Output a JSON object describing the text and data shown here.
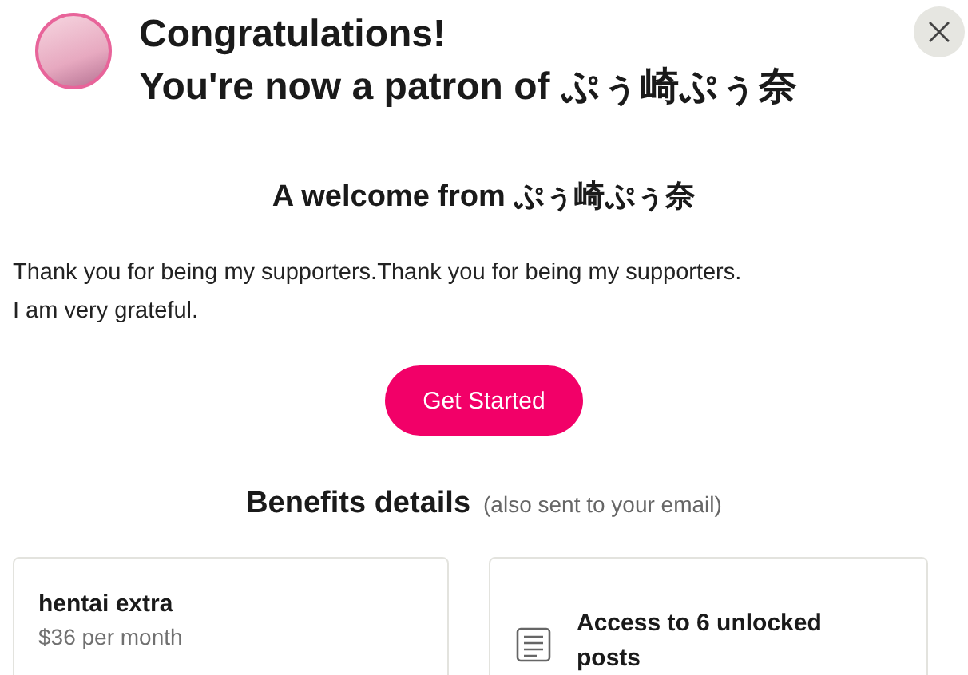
{
  "header": {
    "title_lines": [
      "Congratulations!",
      "You're now a patron of ぷぅ崎ぷぅ奈"
    ]
  },
  "welcome": {
    "heading": "A welcome from ぷぅ崎ぷぅ奈",
    "message_lines": [
      "Thank you for being my supporters.Thank you for being my supporters.",
      "I am very grateful."
    ]
  },
  "cta_button": "Get Started",
  "benefits": {
    "heading": "Benefits details",
    "note": "(also sent to your email)"
  },
  "tier": {
    "name": "hentai extra",
    "price": "$36 per month"
  },
  "perks": [
    {
      "text": "Access to 6 unlocked posts"
    }
  ]
}
